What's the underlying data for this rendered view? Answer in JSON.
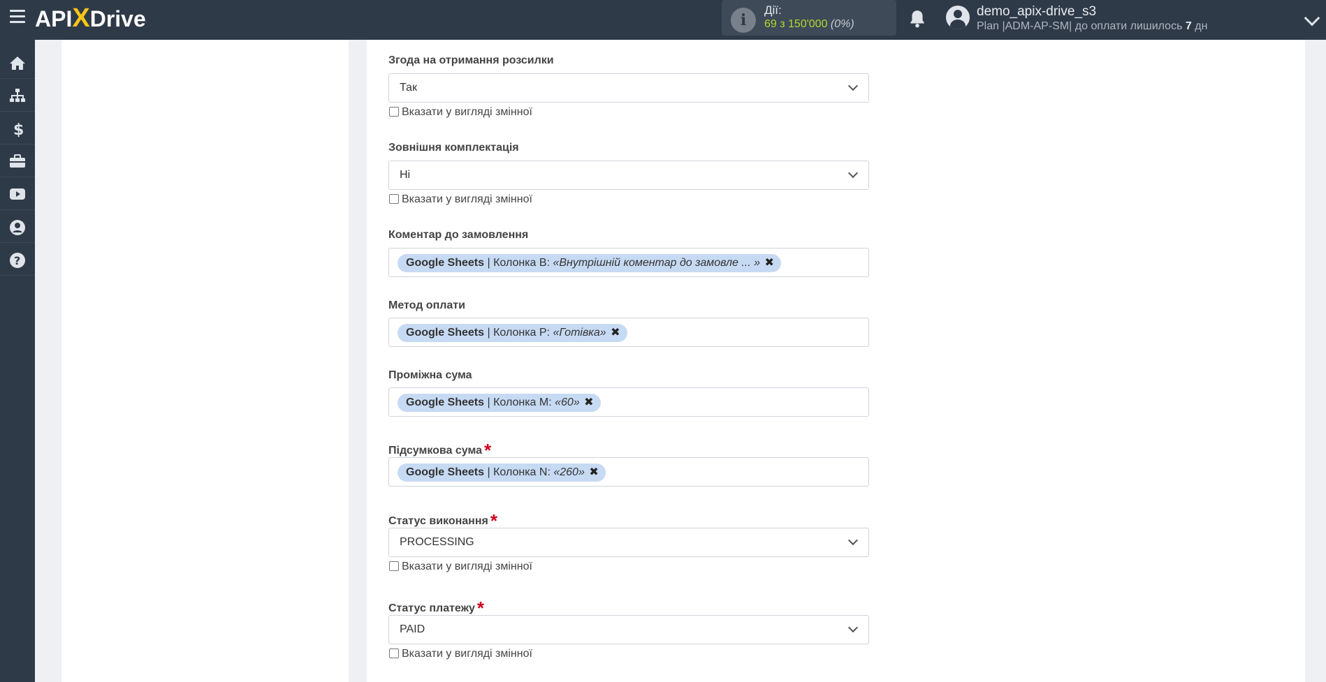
{
  "header": {
    "logo_left": "API",
    "logo_x": "X",
    "logo_right": "Drive",
    "actions_title": "Дії:",
    "actions_count": "69 з 150'000",
    "actions_percent": "(0%)",
    "user_name": "demo_apix-drive_s3",
    "plan_text": "Plan |ADM-AP-SM| до оплати лишилось",
    "plan_days": "7",
    "plan_unit": "дн"
  },
  "sidebar": {
    "icons": [
      "home-icon",
      "sitemap-icon",
      "dollar-icon",
      "briefcase-icon",
      "youtube-icon",
      "user-circle-icon",
      "help-icon"
    ]
  },
  "form": {
    "checkbox_label": "Вказати у вигляді змінної",
    "fields": [
      {
        "label": "Згода на отримання розсилки",
        "type": "select",
        "value": "Так"
      },
      {
        "label": "Зовнішня комплектація",
        "type": "select",
        "value": "Ні"
      },
      {
        "label": "Коментар до замовлення",
        "type": "tag",
        "source": "Google Sheets",
        "column": "| Колонка B:",
        "value": "«Внутрішній коментар до замовле ... »"
      },
      {
        "label": "Метод оплати",
        "type": "tag",
        "source": "Google Sheets",
        "column": "| Колонка P:",
        "value": "«Готівка»"
      },
      {
        "label": "Проміжна сума",
        "type": "tag",
        "source": "Google Sheets",
        "column": "| Колонка M:",
        "value": "«60»"
      },
      {
        "label": "Підсумкова сума",
        "required": true,
        "type": "tag",
        "source": "Google Sheets",
        "column": "| Колонка N:",
        "value": "«260»"
      },
      {
        "label": "Статус виконання",
        "required": true,
        "type": "select",
        "value": "PROCESSING"
      },
      {
        "label": "Статус платежу",
        "required": true,
        "type": "select",
        "value": "PAID"
      }
    ],
    "required_mark": "*",
    "remove_mark": "✖"
  }
}
